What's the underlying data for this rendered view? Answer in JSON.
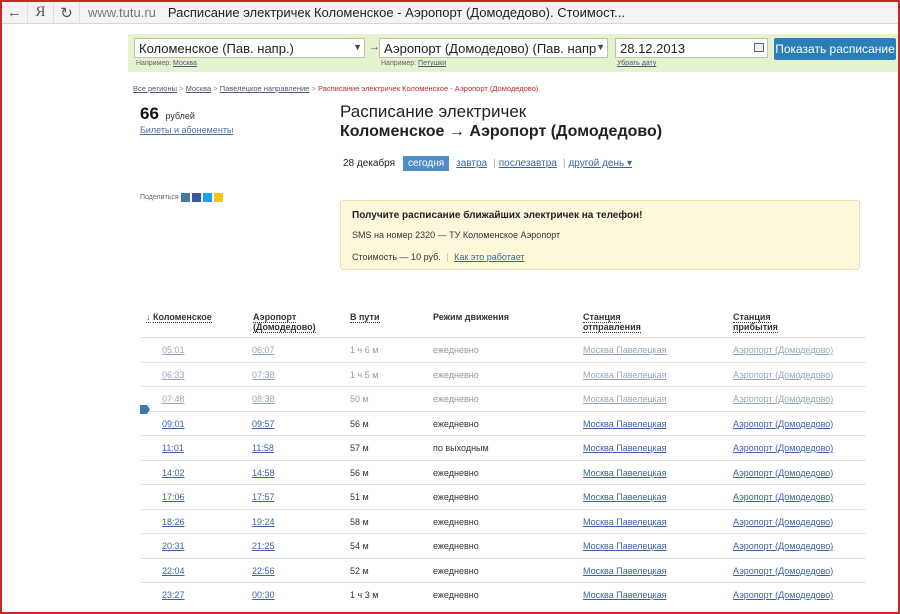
{
  "browser": {
    "back_glyph": "←",
    "logo": "Я",
    "reload_glyph": "↻",
    "url": "www.tutu.ru",
    "title": "Расписание электричек Коломенское - Аэропорт (Домодедово). Стоимост..."
  },
  "search": {
    "from_value": "Коломенское (Пав. напр.)",
    "from_hint_prefix": "Например:",
    "from_hint_example": "Москва",
    "arrow": "→",
    "to_value": "Аэропорт (Домодедово) (Пав. напр",
    "to_hint_prefix": "Например:",
    "to_hint_example": "Петушки",
    "date_value": "28.12.2013",
    "date_hint": "Убрать дату",
    "submit_label": "Показать расписание"
  },
  "breadcrumbs": {
    "items": [
      "Все регионы",
      "Москва",
      "Павелецкое направление"
    ],
    "separator": ">",
    "current": "Расписание электричек Коломенское - Аэропорт (Домодедово)"
  },
  "price": {
    "amount": "66",
    "currency": "рублей",
    "tickets_link": "Билеты и абонементы"
  },
  "heading": {
    "title": "Расписание электричек",
    "route": "Коломенское → Аэропорт (Домодедово)"
  },
  "days": {
    "date": "28 декабря",
    "today": "сегодня",
    "tomorrow": "завтра",
    "day_after": "послезавтра",
    "other": "другой день ▾"
  },
  "share": {
    "label": "Поделиться"
  },
  "sms": {
    "title": "Получите расписание ближайших электричек на телефон!",
    "line": "SMS на номер 2320 — ТУ Коломенское Аэропорт",
    "cost": "Стоимость — 10 руб.",
    "how_link": "Как это работает"
  },
  "table": {
    "headers": {
      "from": "Коломенское",
      "sort_arrow": "↓",
      "to_line1": "Аэропорт",
      "to_line2": "(Домодедово)",
      "duration": "В пути",
      "mode": "Режим движения",
      "dep_line1": "Станция",
      "dep_line2": "отправления",
      "arr_line1": "Станция",
      "arr_line2": "прибытия"
    },
    "rows": [
      {
        "dep": "05:01",
        "arr": "06:07",
        "dur": "1 ч 6 м",
        "mode": "ежедневно",
        "st_from": "Москва Павелецкая",
        "st_to": "Аэропорт (Домодедово)"
      },
      {
        "dep": "06:33",
        "arr": "07:38",
        "dur": "1 ч 5 м",
        "mode": "ежедневно",
        "st_from": "Москва Павелецкая",
        "st_to": "Аэропорт (Домодедово)"
      },
      {
        "dep": "07:48",
        "arr": "08:38",
        "dur": "50 м",
        "mode": "ежедневно",
        "st_from": "Москва Павелецкая",
        "st_to": "Аэропорт (Домодедово)"
      },
      {
        "dep": "09:01",
        "arr": "09:57",
        "dur": "56 м",
        "mode": "ежедневно",
        "st_from": "Москва Павелецкая",
        "st_to": "Аэропорт (Домодедово)"
      },
      {
        "dep": "11:01",
        "arr": "11:58",
        "dur": "57 м",
        "mode": "по выходным",
        "st_from": "Москва Павелецкая",
        "st_to": "Аэропорт (Домодедово)"
      },
      {
        "dep": "14:02",
        "arr": "14:58",
        "dur": "56 м",
        "mode": "ежедневно",
        "st_from": "Москва Павелецкая",
        "st_to": "Аэропорт (Домодедово)"
      },
      {
        "dep": "17:06",
        "arr": "17:57",
        "dur": "51 м",
        "mode": "ежедневно",
        "st_from": "Москва Павелецкая",
        "st_to": "Аэропорт (Домодедово)"
      },
      {
        "dep": "18:26",
        "arr": "19:24",
        "dur": "58 м",
        "mode": "ежедневно",
        "st_from": "Москва Павелецкая",
        "st_to": "Аэропорт (Домодедово)"
      },
      {
        "dep": "20:31",
        "arr": "21:25",
        "dur": "54 м",
        "mode": "ежедневно",
        "st_from": "Москва Павелецкая",
        "st_to": "Аэропорт (Домодедово)"
      },
      {
        "dep": "22:04",
        "arr": "22:56",
        "dur": "52 м",
        "mode": "ежедневно",
        "st_from": "Москва Павелецкая",
        "st_to": "Аэропорт (Домодедово)"
      },
      {
        "dep": "23:27",
        "arr": "00:30",
        "dur": "1 ч 3 м",
        "mode": "ежедневно",
        "st_from": "Москва Павелецкая",
        "st_to": "Аэропорт (Домодедово)"
      }
    ]
  }
}
